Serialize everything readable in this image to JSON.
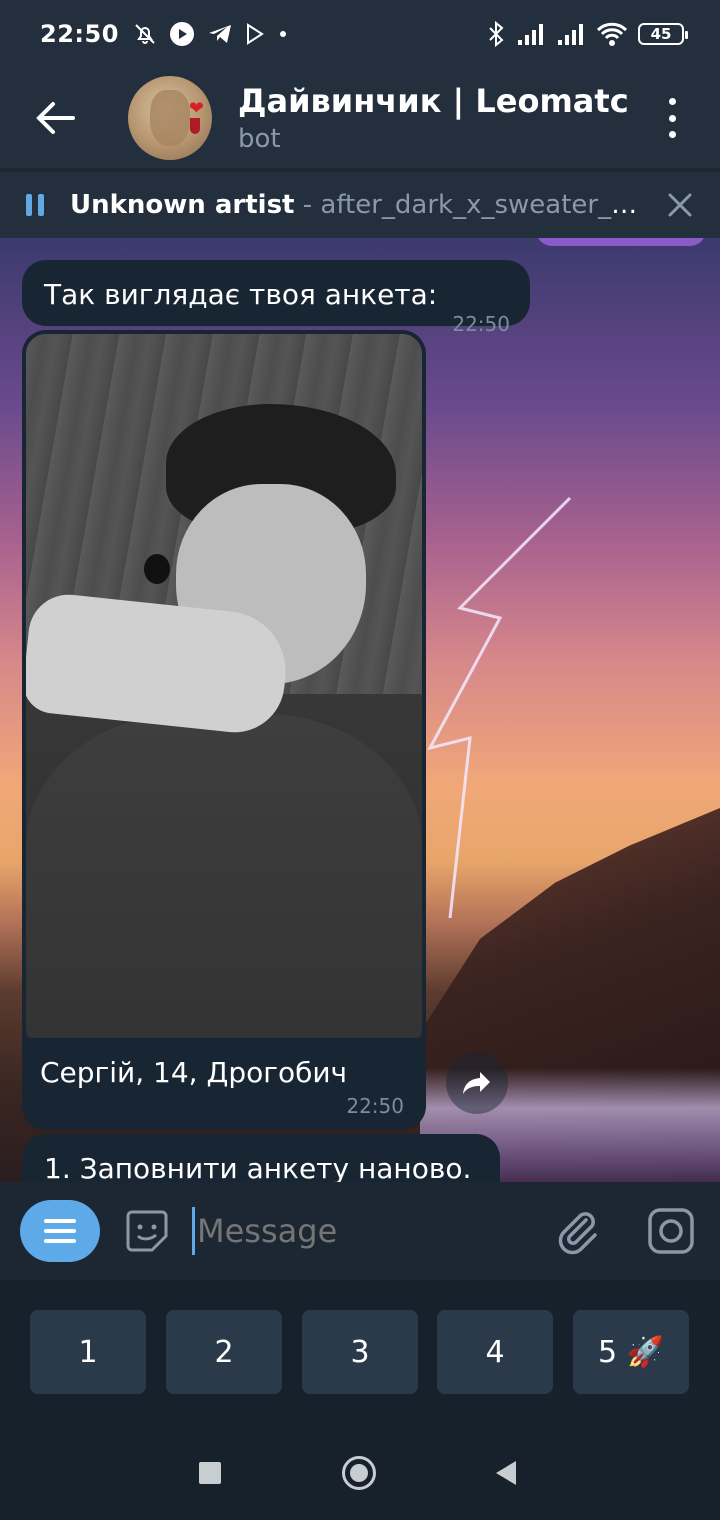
{
  "status_bar": {
    "time": "22:50",
    "battery": "45",
    "icons_left": [
      "mute-icon",
      "youtube-icon",
      "telegram-icon",
      "play-store-icon",
      "dot-icon"
    ],
    "icons_right": [
      "bluetooth-icon",
      "signal-icon",
      "signal-icon",
      "wifi-icon",
      "battery-icon"
    ]
  },
  "header": {
    "title": "Дайвинчик | Leomatchbot",
    "subtitle": "bot"
  },
  "player": {
    "artist": "Unknown artist",
    "separator": " - ",
    "title": "after_dark_x_sweater_weather"
  },
  "messages": {
    "m1_text": "Так виглядає твоя анкета:",
    "m1_time": "22:50",
    "m2_caption": "Сергій, 14, Дрогобич",
    "m2_time": "22:50",
    "m3_text": "1. Заповнити анкету наново."
  },
  "input": {
    "placeholder": "Message"
  },
  "keyboard": {
    "keys": [
      "1",
      "2",
      "3",
      "4",
      "5 🚀"
    ]
  },
  "colors": {
    "accent": "#5ea9e8",
    "bubble": "#182533",
    "header_bg": "#242f3d",
    "keyboard_key": "#2b3a4b"
  }
}
